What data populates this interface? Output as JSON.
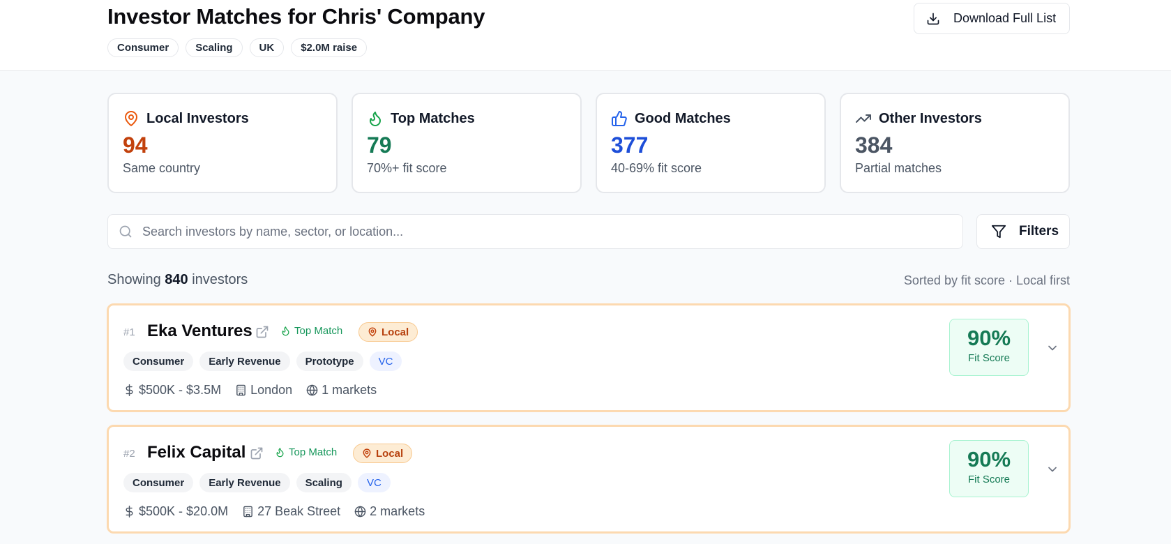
{
  "header": {
    "title": "Investor Matches for Chris' Company",
    "tags": [
      "Consumer",
      "Scaling",
      "UK",
      "$2.0M raise"
    ],
    "download_label": "Download Full List"
  },
  "stats": [
    {
      "title": "Local Investors",
      "value": "94",
      "subtitle": "Same country",
      "icon": "map-pin-icon",
      "color": "#c2410c"
    },
    {
      "title": "Top Matches",
      "value": "79",
      "subtitle": "70%+ fit score",
      "icon": "flame-icon",
      "color": "#157a55"
    },
    {
      "title": "Good Matches",
      "value": "377",
      "subtitle": "40-69% fit score",
      "icon": "thumbs-up-icon",
      "color": "#1d4ed8"
    },
    {
      "title": "Other Investors",
      "value": "384",
      "subtitle": "Partial matches",
      "icon": "trending-up-icon",
      "color": "#4b5563"
    }
  ],
  "search": {
    "placeholder": "Search investors by name, sector, or location..."
  },
  "filters_label": "Filters",
  "results": {
    "showing_prefix": "Showing",
    "count": "840",
    "showing_suffix": "investors",
    "sorted_label": "Sorted by fit score · Local first"
  },
  "investors": [
    {
      "rank": "#1",
      "name": "Eka Ventures",
      "top_match_label": "Top Match",
      "local_label": "Local",
      "tags": [
        "Consumer",
        "Early Revenue",
        "Prototype"
      ],
      "type_tag": "VC",
      "cheque": "$500K - $3.5M",
      "location": "London",
      "markets": "1 markets",
      "fit_score": "90%",
      "fit_label": "Fit Score"
    },
    {
      "rank": "#2",
      "name": "Felix Capital",
      "top_match_label": "Top Match",
      "local_label": "Local",
      "tags": [
        "Consumer",
        "Early Revenue",
        "Scaling"
      ],
      "type_tag": "VC",
      "cheque": "$500K - $20.0M",
      "location": "27 Beak Street",
      "markets": "2 markets",
      "fit_score": "90%",
      "fit_label": "Fit Score"
    }
  ]
}
